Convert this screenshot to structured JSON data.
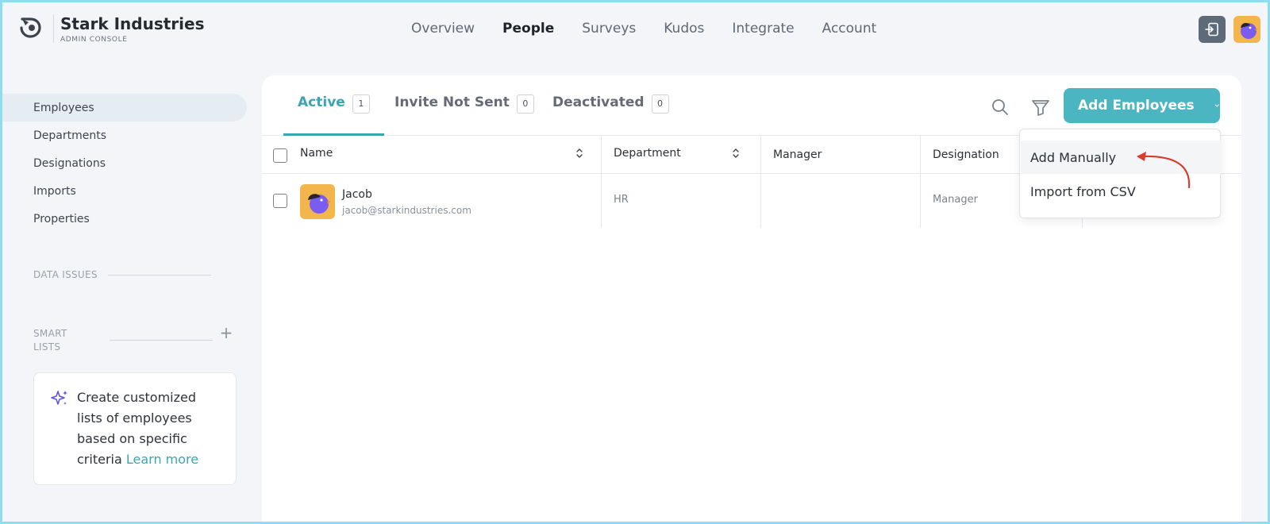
{
  "header": {
    "brand_name": "Stark Industries",
    "brand_sub": "ADMIN CONSOLE",
    "nav": [
      {
        "label": "Overview",
        "active": false
      },
      {
        "label": "People",
        "active": true
      },
      {
        "label": "Surveys",
        "active": false
      },
      {
        "label": "Kudos",
        "active": false
      },
      {
        "label": "Integrate",
        "active": false
      },
      {
        "label": "Account",
        "active": false
      }
    ],
    "icons": {
      "exit": "sign-in-icon",
      "user_avatar": "bird-avatar-icon"
    }
  },
  "sidebar": {
    "items": [
      {
        "label": "Employees",
        "active": true
      },
      {
        "label": "Departments",
        "active": false
      },
      {
        "label": "Designations",
        "active": false
      },
      {
        "label": "Imports",
        "active": false
      },
      {
        "label": "Properties",
        "active": false
      }
    ],
    "data_issues_label": "DATA ISSUES",
    "smart_lists_label": "SMART LISTS",
    "smart_lists_add": "+",
    "promo": {
      "icon": "sparkles-icon",
      "text": "Create customized lists of employees based on specific criteria",
      "link": "Learn more"
    }
  },
  "tabs": [
    {
      "label": "Active",
      "count": "1",
      "active": true
    },
    {
      "label": "Invite Not Sent",
      "count": "0",
      "active": false
    },
    {
      "label": "Deactivated",
      "count": "0",
      "active": false
    }
  ],
  "toolbar": {
    "search_icon": "search-icon",
    "filter_icon": "filter-icon",
    "add_button": "Add Employees"
  },
  "table": {
    "columns": [
      "Name",
      "Department",
      "Manager",
      "Designation"
    ],
    "rows": [
      {
        "name": "Jacob",
        "email": "jacob@starkindustries.com",
        "department": "HR",
        "manager": "",
        "designation": "Manager"
      }
    ]
  },
  "dropdown": {
    "items": [
      "Add Manually",
      "Import from CSV"
    ]
  },
  "colors": {
    "accent": "#4bb5c2",
    "accent_text": "#3aa6b5",
    "annotation_arrow": "#d93a2b",
    "avatar_bg": "#f3b64d"
  }
}
